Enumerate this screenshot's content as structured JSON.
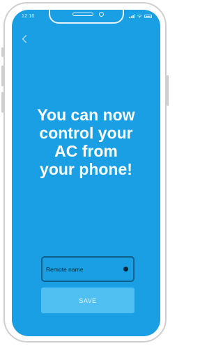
{
  "status_bar": {
    "time": "12:10"
  },
  "nav": {
    "back_icon": "chevron-left-icon"
  },
  "headline": {
    "lines": [
      "You can now",
      "control your",
      "AC from",
      "your phone!"
    ]
  },
  "form": {
    "remote_name_placeholder": "Remote name",
    "remote_name_value": "",
    "save_label": "SAVE"
  },
  "colors": {
    "screen_background": "#1a9ee4",
    "save_button_background": "#4fc0f1",
    "input_border": "#0e5f8c",
    "headline_text": "#ffffff"
  }
}
